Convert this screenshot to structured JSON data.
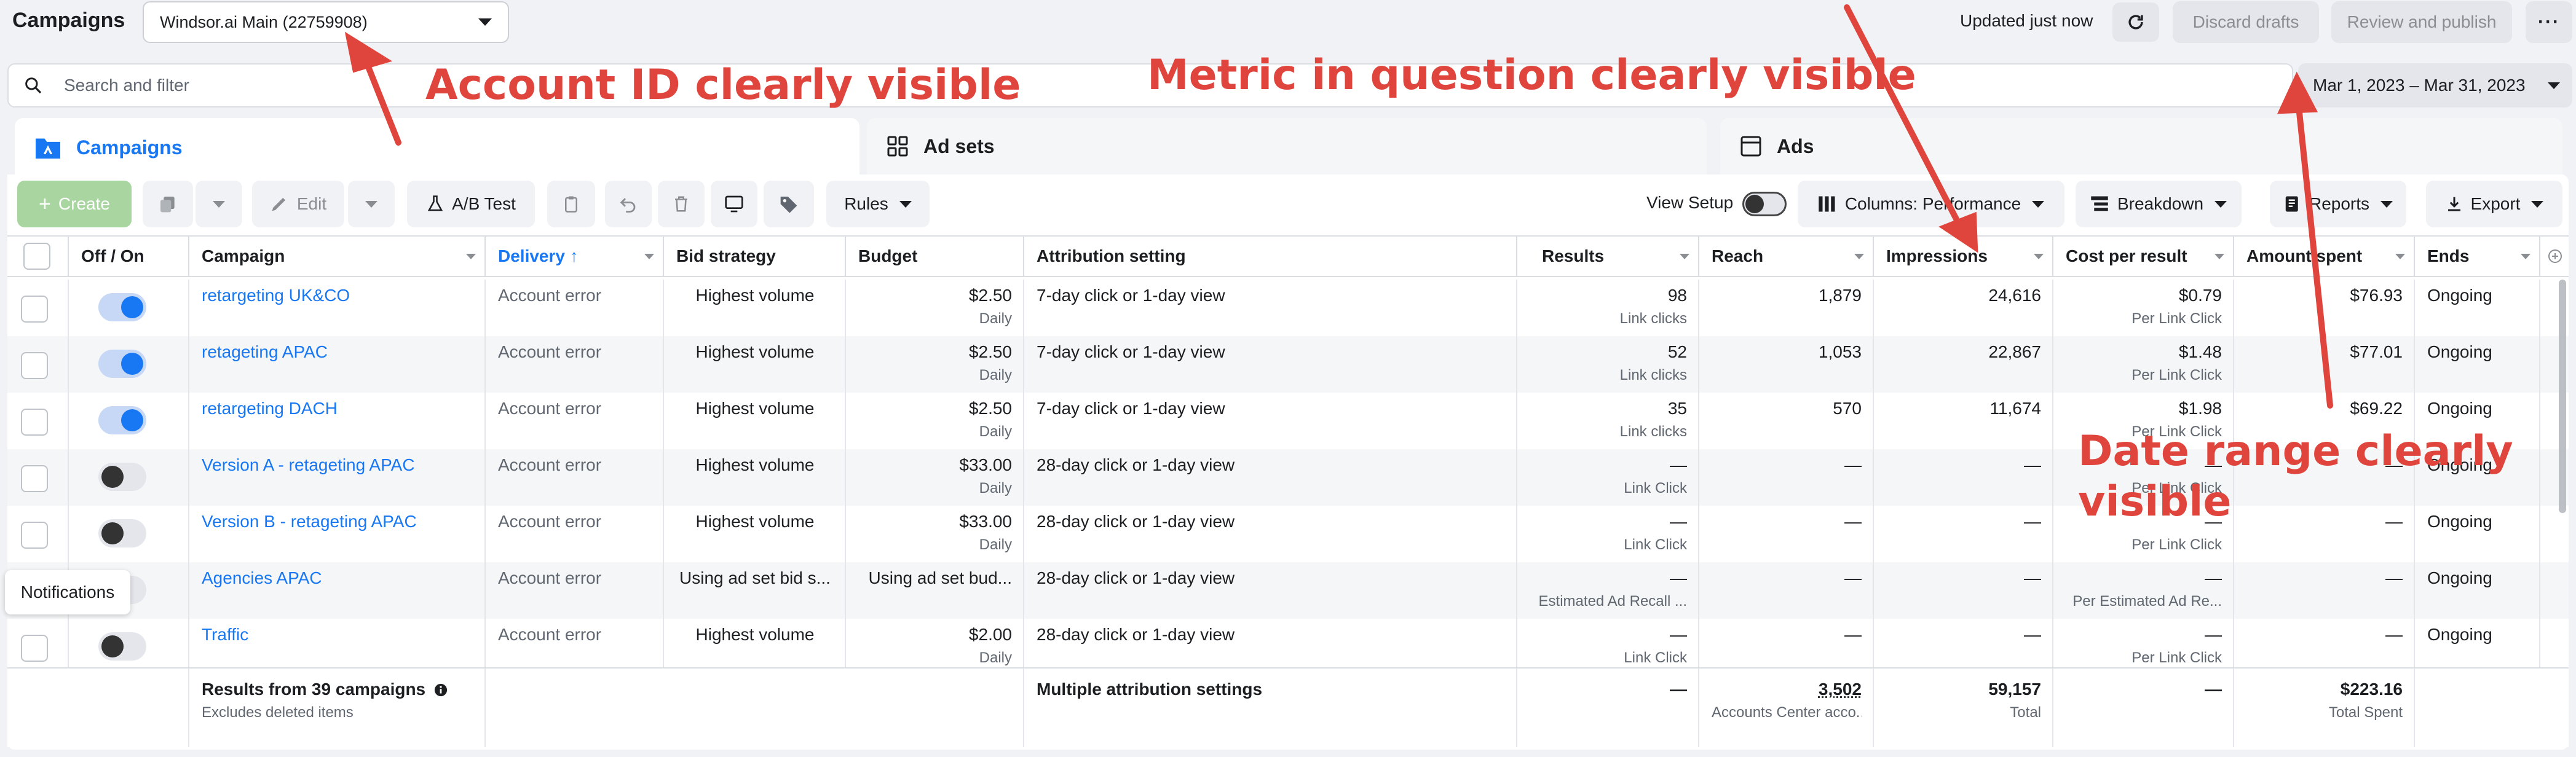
{
  "header": {
    "title": "Campaigns",
    "account": "Windsor.ai Main (22759908)",
    "updated": "Updated just now",
    "discard": "Discard drafts",
    "review": "Review and publish",
    "more": "···"
  },
  "search": {
    "placeholder": "Search and filter",
    "date_range": "Mar 1, 2023 – Mar 31, 2023"
  },
  "tabs": [
    "Campaigns",
    "Ad sets",
    "Ads"
  ],
  "toolbar": {
    "create": "Create",
    "edit": "Edit",
    "ab_test": "A/B Test",
    "rules": "Rules",
    "view_setup": "View Setup",
    "columns": "Columns: Performance",
    "breakdown": "Breakdown",
    "reports": "Reports",
    "export": "Export"
  },
  "columns": [
    "Off / On",
    "Campaign",
    "Delivery ↑",
    "Bid strategy",
    "Budget",
    "Attribution setting",
    "Results",
    "Reach",
    "Impressions",
    "Cost per result",
    "Amount spent",
    "Ends"
  ],
  "rows": [
    {
      "on": true,
      "campaign": "retargeting UK&CO",
      "delivery": "Account error",
      "bid": "Highest volume",
      "budget": "$2.50",
      "budget_sub": "Daily",
      "attribution": "7-day click or 1-day view",
      "results": "98",
      "results_sub": "Link clicks",
      "reach": "1,879",
      "impressions": "24,616",
      "cpr": "$0.79",
      "cpr_sub": "Per Link Click",
      "spent": "$76.93",
      "ends": "Ongoing"
    },
    {
      "on": true,
      "campaign": "retageting APAC",
      "delivery": "Account error",
      "bid": "Highest volume",
      "budget": "$2.50",
      "budget_sub": "Daily",
      "attribution": "7-day click or 1-day view",
      "results": "52",
      "results_sub": "Link clicks",
      "reach": "1,053",
      "impressions": "22,867",
      "cpr": "$1.48",
      "cpr_sub": "Per Link Click",
      "spent": "$77.01",
      "ends": "Ongoing"
    },
    {
      "on": true,
      "campaign": "retargeting DACH",
      "delivery": "Account error",
      "bid": "Highest volume",
      "budget": "$2.50",
      "budget_sub": "Daily",
      "attribution": "7-day click or 1-day view",
      "results": "35",
      "results_sub": "Link clicks",
      "reach": "570",
      "impressions": "11,674",
      "cpr": "$1.98",
      "cpr_sub": "Per Link Click",
      "spent": "$69.22",
      "ends": "Ongoing"
    },
    {
      "on": false,
      "campaign": "Version A - retageting APAC",
      "delivery": "Account error",
      "bid": "Highest volume",
      "budget": "$33.00",
      "budget_sub": "Daily",
      "attribution": "28-day click or 1-day view",
      "results": "—",
      "results_sub": "Link Click",
      "reach": "—",
      "impressions": "—",
      "cpr": "—",
      "cpr_sub": "Per Link Click",
      "spent": "—",
      "ends": "Ongoing"
    },
    {
      "on": false,
      "campaign": "Version B - retageting APAC",
      "delivery": "Account error",
      "bid": "Highest volume",
      "budget": "$33.00",
      "budget_sub": "Daily",
      "attribution": "28-day click or 1-day view",
      "results": "—",
      "results_sub": "Link Click",
      "reach": "—",
      "impressions": "—",
      "cpr": "—",
      "cpr_sub": "Per Link Click",
      "spent": "—",
      "ends": "Ongoing"
    },
    {
      "on": false,
      "campaign": "Agencies APAC",
      "delivery": "Account error",
      "bid": "Using ad set bid s...",
      "budget": "Using ad set bud...",
      "budget_sub": "",
      "attribution": "28-day click or 1-day view",
      "results": "—",
      "results_sub": "Estimated Ad Recall ...",
      "reach": "—",
      "impressions": "—",
      "cpr": "—",
      "cpr_sub": "Per Estimated Ad Re...",
      "spent": "—",
      "ends": "Ongoing"
    },
    {
      "on": false,
      "campaign": "Traffic",
      "delivery": "Account error",
      "bid": "Highest volume",
      "budget": "$2.00",
      "budget_sub": "Daily",
      "attribution": "28-day click or 1-day view",
      "results": "—",
      "results_sub": "Link Click",
      "reach": "—",
      "impressions": "—",
      "cpr": "—",
      "cpr_sub": "Per Link Click",
      "spent": "—",
      "ends": "Ongoing"
    }
  ],
  "footer": {
    "title": "Results from 39 campaigns",
    "sub": "Excludes deleted items",
    "attribution": "Multiple attribution settings",
    "results": "—",
    "reach": "3,502",
    "reach_sub": "Accounts Center acco...",
    "impressions": "59,157",
    "impressions_sub": "Total",
    "cpr": "—",
    "spent": "$223.16",
    "spent_sub": "Total Spent"
  },
  "notifications": "Notifications",
  "annotations": {
    "account": "Account ID clearly visible",
    "metric": "Metric in question clearly visible",
    "date_line1": "Date range clearly",
    "date_line2": "visible"
  },
  "colors": {
    "accent": "#1877f2",
    "annotation": "#e0453d",
    "create": "#a8d5a0"
  },
  "icons": [
    "search-icon",
    "refresh-icon",
    "campaign-folder-icon",
    "ad-sets-grid-icon",
    "ads-page-icon",
    "duplicate-icon",
    "pencil-icon",
    "flask-icon",
    "clipboard-icon",
    "undo-icon",
    "trash-icon",
    "tag-icon",
    "columns-icon",
    "breakdown-icon",
    "reports-icon",
    "download-icon",
    "info-icon"
  ]
}
